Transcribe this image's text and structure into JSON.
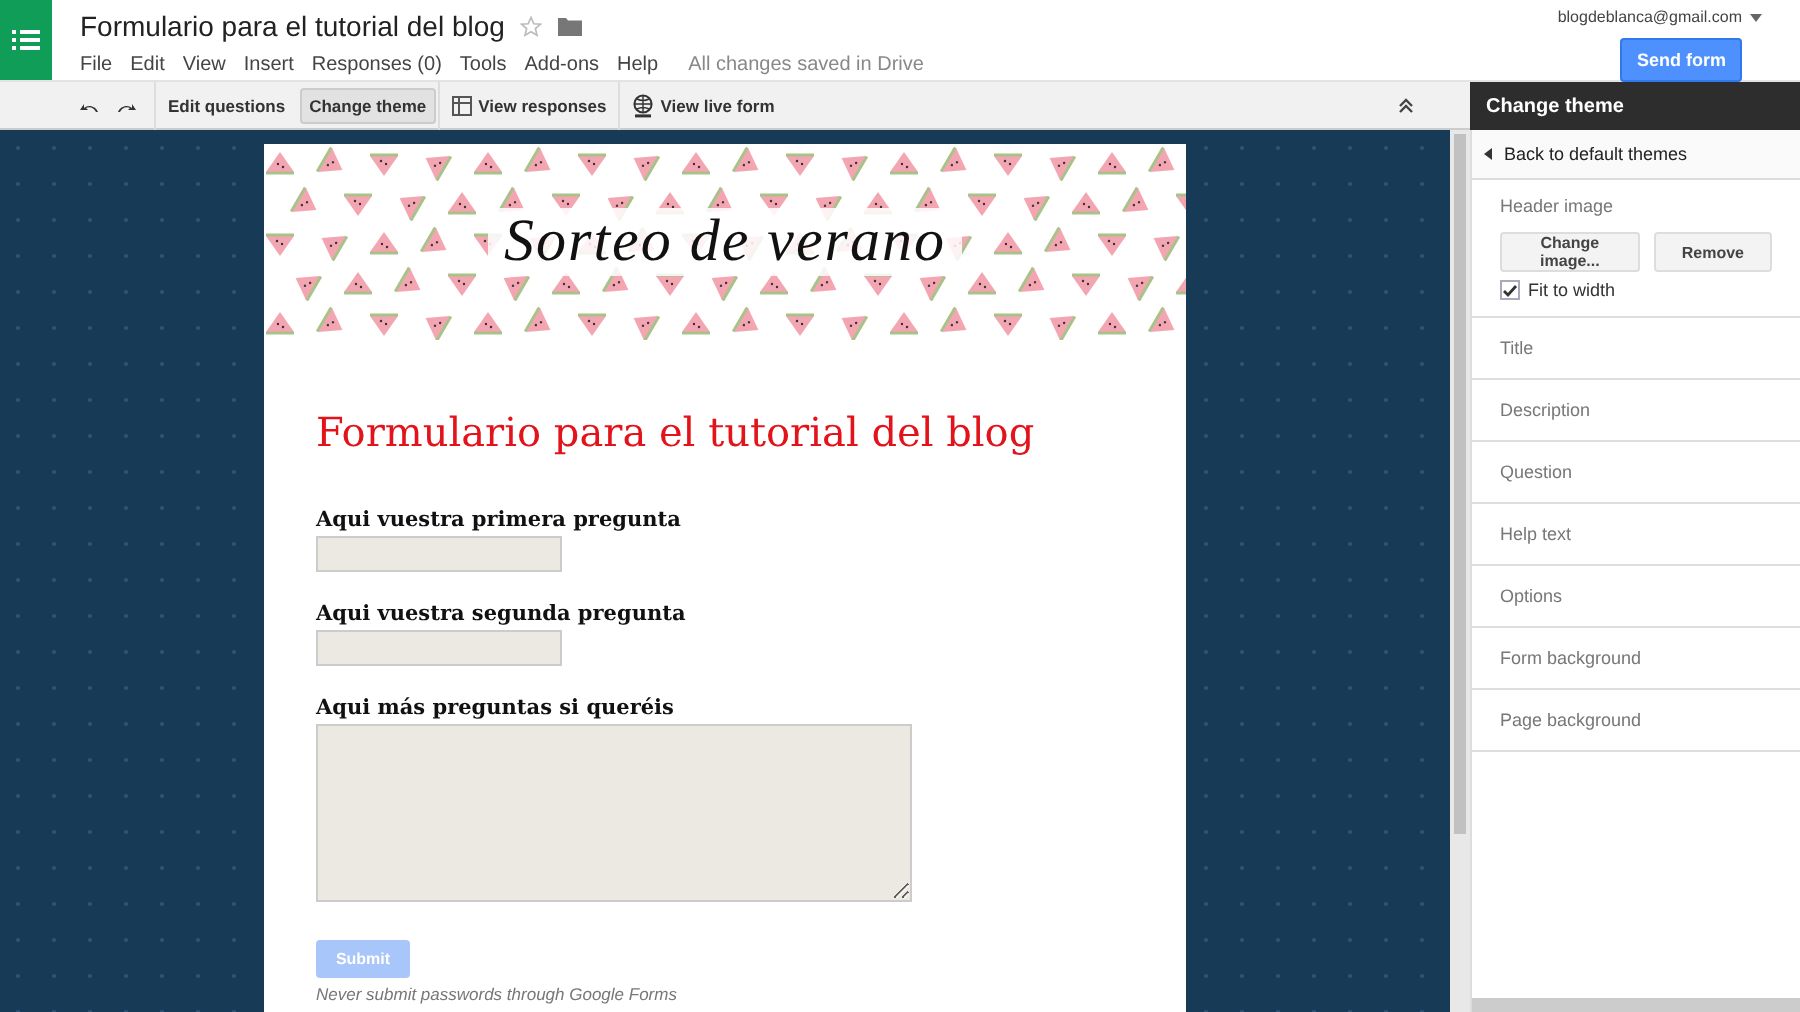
{
  "app": {
    "title": "Formulario para el tutorial del blog",
    "starred": false,
    "menu": [
      "File",
      "Edit",
      "View",
      "Insert",
      "Responses (0)",
      "Tools",
      "Add-ons",
      "Help"
    ],
    "save_status": "All changes saved in Drive",
    "account": "blogdeblanca@gmail.com",
    "send_button": "Send form"
  },
  "toolbar": {
    "items": [
      {
        "label": "Edit questions",
        "kind": "plain",
        "selected": false
      },
      {
        "label": "Change theme",
        "kind": "plain",
        "selected": true
      },
      {
        "label": "View responses",
        "kind": "grid",
        "selected": false
      },
      {
        "label": "View live form",
        "kind": "globe",
        "selected": false
      }
    ]
  },
  "form": {
    "header_text": "Sorteo de verano",
    "title": "Formulario para el tutorial del blog",
    "questions": [
      {
        "label": "Aqui vuestra primera pregunta",
        "kind": "short"
      },
      {
        "label": "Aqui vuestra segunda pregunta",
        "kind": "short"
      },
      {
        "label": "Aqui más preguntas si queréis",
        "kind": "paragraph"
      }
    ],
    "submit": {
      "label": "Submit",
      "disabled": true
    },
    "footer_note": "Never submit passwords through Google Forms"
  },
  "theme_panel": {
    "title": "Change theme",
    "back_link": "Back to default themes",
    "header_image": {
      "label": "Header image",
      "buttons": [
        "Change image...",
        "Remove"
      ],
      "fit_to_width": {
        "label": "Fit to width",
        "checked": true
      }
    },
    "sections": [
      "Title",
      "Description",
      "Question",
      "Help text",
      "Options",
      "Form background",
      "Page background"
    ]
  }
}
